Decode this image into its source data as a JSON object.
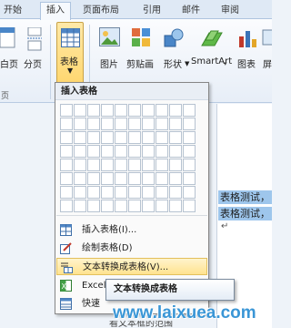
{
  "tabs": [
    {
      "label": "开始",
      "active": false
    },
    {
      "label": "插入",
      "active": true
    },
    {
      "label": "页面布局",
      "active": false
    },
    {
      "label": "引用",
      "active": false
    },
    {
      "label": "邮件",
      "active": false
    },
    {
      "label": "审阅",
      "active": false
    }
  ],
  "ribbon": {
    "cover_label": "白页",
    "page_break_label": "分页",
    "table_label": "表格",
    "picture_label": "图片",
    "clipart_label": "剪贴画",
    "shapes_label": "形状",
    "smartart_label": "SmartArt",
    "chart_label": "图表",
    "screenshot_label": "屏",
    "pages_group_label": "页",
    "smartart_dropdown_marker": "▾"
  },
  "dropdown": {
    "header": "插入表格",
    "grid_cols": 10,
    "grid_rows": 8,
    "items": [
      {
        "label": "插入表格(I)...",
        "icon": "insert-table-icon"
      },
      {
        "label": "绘制表格(D)",
        "icon": "draw-table-icon"
      },
      {
        "label": "文本转换成表格(V)...",
        "icon": "convert-text-to-table-icon",
        "highlighted": true
      },
      {
        "label": "Excel",
        "icon": "excel-icon"
      },
      {
        "label": "快速",
        "icon": "quick-tables-icon"
      }
    ]
  },
  "tooltip": {
    "title": "文本转换成表格"
  },
  "document": {
    "lines": [
      "表格测试，",
      "表格测试，"
    ],
    "paragraph_mark": "↵",
    "partial_line": "看文本框的范围"
  },
  "watermark": {
    "text": "www.laixuea.com"
  },
  "colors": {
    "accent": "#ffd466",
    "selection": "#9ec6ec",
    "watermark": "#3a96d6"
  }
}
